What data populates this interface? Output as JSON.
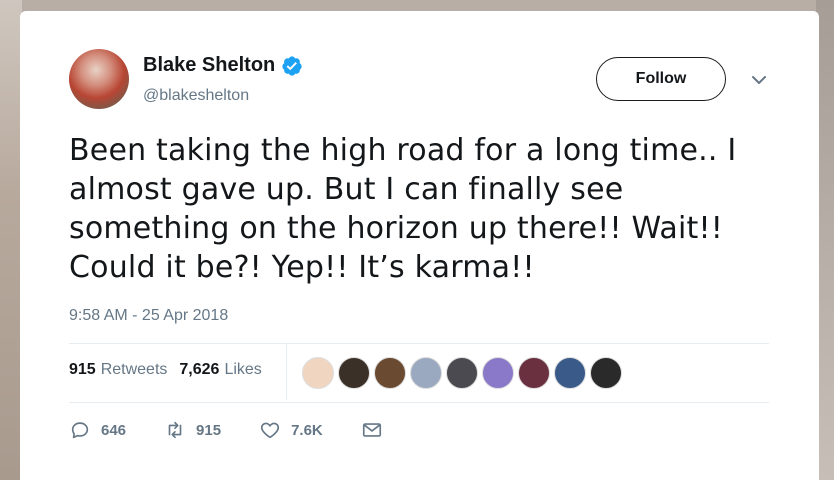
{
  "user": {
    "name": "Blake Shelton",
    "handle": "@blakeshelton",
    "verified_icon": "verified-badge-icon"
  },
  "follow_label": "Follow",
  "tweet": {
    "text": "Been taking the high road for a long time.. I\nalmost gave up.  But I can finally see\nsomething on the horizon up there!! Wait!!\nCould it be?! Yep!! It’s karma!!",
    "timestamp": "9:58 AM - 25 Apr 2018"
  },
  "stats": {
    "retweets_count": "915",
    "retweets_label": "Retweets",
    "likes_count": "7,626",
    "likes_label": "Likes"
  },
  "liker_avatars": [
    {
      "color": "#f0d6c0"
    },
    {
      "color": "#3a3028"
    },
    {
      "color": "#6a4a30"
    },
    {
      "color": "#9aa8c0"
    },
    {
      "color": "#4a4a50"
    },
    {
      "color": "#8a78c8"
    },
    {
      "color": "#6a3040"
    },
    {
      "color": "#3a5a8a"
    },
    {
      "color": "#2a2a2a"
    }
  ],
  "actions": {
    "reply_count": "646",
    "retweet_count": "915",
    "like_count": "7.6K"
  },
  "colors": {
    "accent": "#1da1f2",
    "muted": "#657786",
    "text": "#14171a"
  }
}
